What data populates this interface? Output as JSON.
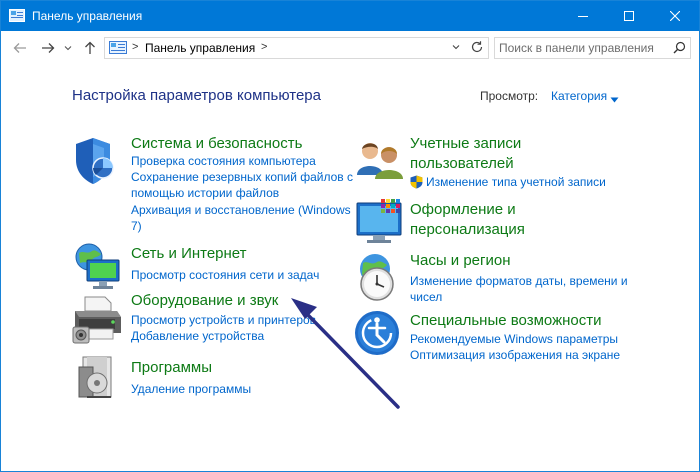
{
  "window": {
    "title": "Панель управления"
  },
  "address": {
    "crumb": "Панель управления"
  },
  "search": {
    "placeholder": "Поиск в панели управления"
  },
  "page": {
    "title": "Настройка параметров компьютера"
  },
  "view": {
    "label": "Просмотр:",
    "value": "Категория"
  },
  "categories_left": [
    {
      "title": "Система и безопасность",
      "links": [
        "Проверка состояния компьютера",
        "Сохранение резервных копий файлов с",
        "помощью истории файлов",
        "Архивация и восстановление (Windows",
        "7)"
      ]
    },
    {
      "title": "Сеть и Интернет",
      "links": [
        "Просмотр состояния сети и задач"
      ]
    },
    {
      "title": "Оборудование и звук",
      "links": [
        "Просмотр устройств и принтеров",
        "Добавление устройства"
      ]
    },
    {
      "title": "Программы",
      "links": [
        "Удаление программы"
      ]
    }
  ],
  "categories_right": [
    {
      "title_lines": [
        "Учетные записи",
        "пользователей"
      ],
      "links": [
        "Изменение типа учетной записи"
      ]
    },
    {
      "title_lines": [
        "Оформление и",
        "персонализация"
      ],
      "links": []
    },
    {
      "title_lines": [
        "Часы и регион"
      ],
      "links": [
        "Изменение форматов даты, времени и",
        "чисел"
      ]
    },
    {
      "title_lines": [
        "Специальные возможности"
      ],
      "links": [
        "Рекомендуемые Windows параметры",
        "Оптимизация изображения на экране"
      ]
    }
  ],
  "colors": {
    "titlebar": "#0078d7",
    "category_title": "#0d7a15",
    "link": "#0066cc",
    "page_title": "#1e3287",
    "annotation_arrow": "#2a2f86"
  }
}
